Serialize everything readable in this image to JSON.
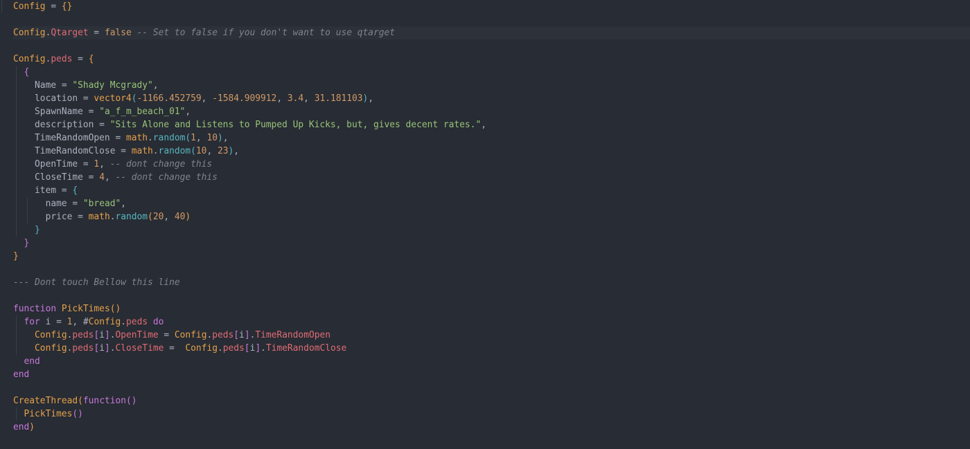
{
  "editor": {
    "active_line": 2,
    "lines": [
      [
        [
          "Config",
          "var"
        ],
        [
          " = ",
          "p"
        ],
        [
          "{}",
          "br1"
        ]
      ],
      [],
      [
        [
          "Config",
          "var"
        ],
        [
          ".",
          "p"
        ],
        [
          "Qtarget",
          "prop"
        ],
        [
          " = ",
          "p"
        ],
        [
          "false",
          "num"
        ],
        [
          " -- Set to false if you don't want to use qtarget",
          "com"
        ]
      ],
      [],
      [
        [
          "Config",
          "var"
        ],
        [
          ".",
          "p"
        ],
        [
          "peds",
          "prop"
        ],
        [
          " = ",
          "p"
        ],
        [
          "{",
          "br1"
        ]
      ],
      [
        [
          "  ",
          "p"
        ],
        [
          "{",
          "br2"
        ]
      ],
      [
        [
          "    Name = ",
          "p"
        ],
        [
          "\"Shady Mcgrady\"",
          "str"
        ],
        [
          ",",
          "p"
        ]
      ],
      [
        [
          "    location = ",
          "p"
        ],
        [
          "vector4",
          "fn"
        ],
        [
          "(",
          "br3"
        ],
        [
          "-1166.452759",
          "num"
        ],
        [
          ", ",
          "p"
        ],
        [
          "-1584.909912",
          "num"
        ],
        [
          ", ",
          "p"
        ],
        [
          "3.4",
          "num"
        ],
        [
          ", ",
          "p"
        ],
        [
          "31.181103",
          "num"
        ],
        [
          ")",
          "br3"
        ],
        [
          ",",
          "p"
        ]
      ],
      [
        [
          "    SpawnName = ",
          "p"
        ],
        [
          "\"a_f_m_beach_01\"",
          "str"
        ],
        [
          ",",
          "p"
        ]
      ],
      [
        [
          "    description = ",
          "p"
        ],
        [
          "\"Sits Alone and Listens to Pumped Up Kicks, but, gives decent rates.\"",
          "str"
        ],
        [
          ",",
          "p"
        ]
      ],
      [
        [
          "    TimeRandomOpen = ",
          "p"
        ],
        [
          "math",
          "var"
        ],
        [
          ".",
          "p"
        ],
        [
          "random",
          "meth"
        ],
        [
          "(",
          "br3"
        ],
        [
          "1",
          "num"
        ],
        [
          ", ",
          "p"
        ],
        [
          "10",
          "num"
        ],
        [
          ")",
          "br3"
        ],
        [
          ",",
          "p"
        ]
      ],
      [
        [
          "    TimeRandomClose = ",
          "p"
        ],
        [
          "math",
          "var"
        ],
        [
          ".",
          "p"
        ],
        [
          "random",
          "meth"
        ],
        [
          "(",
          "br3"
        ],
        [
          "10",
          "num"
        ],
        [
          ", ",
          "p"
        ],
        [
          "23",
          "num"
        ],
        [
          ")",
          "br3"
        ],
        [
          ",",
          "p"
        ]
      ],
      [
        [
          "    OpenTime = ",
          "p"
        ],
        [
          "1",
          "num"
        ],
        [
          ", ",
          "p"
        ],
        [
          "-- dont change this",
          "com"
        ]
      ],
      [
        [
          "    CloseTime = ",
          "p"
        ],
        [
          "4",
          "num"
        ],
        [
          ", ",
          "p"
        ],
        [
          "-- dont change this",
          "com"
        ]
      ],
      [
        [
          "    item = ",
          "p"
        ],
        [
          "{",
          "br3"
        ]
      ],
      [
        [
          "      name = ",
          "p"
        ],
        [
          "\"bread\"",
          "str"
        ],
        [
          ",",
          "p"
        ]
      ],
      [
        [
          "      price = ",
          "p"
        ],
        [
          "math",
          "var"
        ],
        [
          ".",
          "p"
        ],
        [
          "random",
          "meth"
        ],
        [
          "(",
          "br1"
        ],
        [
          "20",
          "num"
        ],
        [
          ", ",
          "p"
        ],
        [
          "40",
          "num"
        ],
        [
          ")",
          "br1"
        ]
      ],
      [
        [
          "    ",
          "p"
        ],
        [
          "}",
          "br3"
        ]
      ],
      [
        [
          "  ",
          "p"
        ],
        [
          "}",
          "br2"
        ]
      ],
      [
        [
          "}",
          "br1"
        ]
      ],
      [],
      [
        [
          "--- Dont touch Bellow this line",
          "com"
        ]
      ],
      [],
      [
        [
          "function",
          "kw"
        ],
        [
          " ",
          "p"
        ],
        [
          "PickTimes",
          "fn"
        ],
        [
          "()",
          "br1"
        ]
      ],
      [
        [
          "  ",
          "p"
        ],
        [
          "for",
          "kw"
        ],
        [
          " i = ",
          "p"
        ],
        [
          "1",
          "num"
        ],
        [
          ", ",
          "p"
        ],
        [
          "#",
          "p"
        ],
        [
          "Config",
          "var"
        ],
        [
          ".",
          "p"
        ],
        [
          "peds",
          "prop"
        ],
        [
          " ",
          "p"
        ],
        [
          "do",
          "kw"
        ]
      ],
      [
        [
          "    ",
          "p"
        ],
        [
          "Config",
          "var"
        ],
        [
          ".",
          "p"
        ],
        [
          "peds",
          "prop"
        ],
        [
          "[",
          "br2"
        ],
        [
          "i",
          "p"
        ],
        [
          "]",
          "br2"
        ],
        [
          ".",
          "p"
        ],
        [
          "OpenTime",
          "prop"
        ],
        [
          " = ",
          "p"
        ],
        [
          "Config",
          "var"
        ],
        [
          ".",
          "p"
        ],
        [
          "peds",
          "prop"
        ],
        [
          "[",
          "br2"
        ],
        [
          "i",
          "p"
        ],
        [
          "]",
          "br2"
        ],
        [
          ".",
          "p"
        ],
        [
          "TimeRandomOpen",
          "prop"
        ]
      ],
      [
        [
          "    ",
          "p"
        ],
        [
          "Config",
          "var"
        ],
        [
          ".",
          "p"
        ],
        [
          "peds",
          "prop"
        ],
        [
          "[",
          "br2"
        ],
        [
          "i",
          "p"
        ],
        [
          "]",
          "br2"
        ],
        [
          ".",
          "p"
        ],
        [
          "CloseTime",
          "prop"
        ],
        [
          " =  ",
          "p"
        ],
        [
          "Config",
          "var"
        ],
        [
          ".",
          "p"
        ],
        [
          "peds",
          "prop"
        ],
        [
          "[",
          "br2"
        ],
        [
          "i",
          "p"
        ],
        [
          "]",
          "br2"
        ],
        [
          ".",
          "p"
        ],
        [
          "TimeRandomClose",
          "prop"
        ]
      ],
      [
        [
          "  ",
          "p"
        ],
        [
          "end",
          "kw"
        ]
      ],
      [
        [
          "end",
          "kw"
        ]
      ],
      [],
      [
        [
          "CreateThread",
          "fn"
        ],
        [
          "(",
          "br1"
        ],
        [
          "function",
          "kw"
        ],
        [
          "()",
          "br2"
        ]
      ],
      [
        [
          "  ",
          "p"
        ],
        [
          "PickTimes",
          "fn"
        ],
        [
          "()",
          "br2"
        ]
      ],
      [
        [
          "end",
          "kw"
        ],
        [
          ")",
          "br1"
        ]
      ]
    ]
  }
}
